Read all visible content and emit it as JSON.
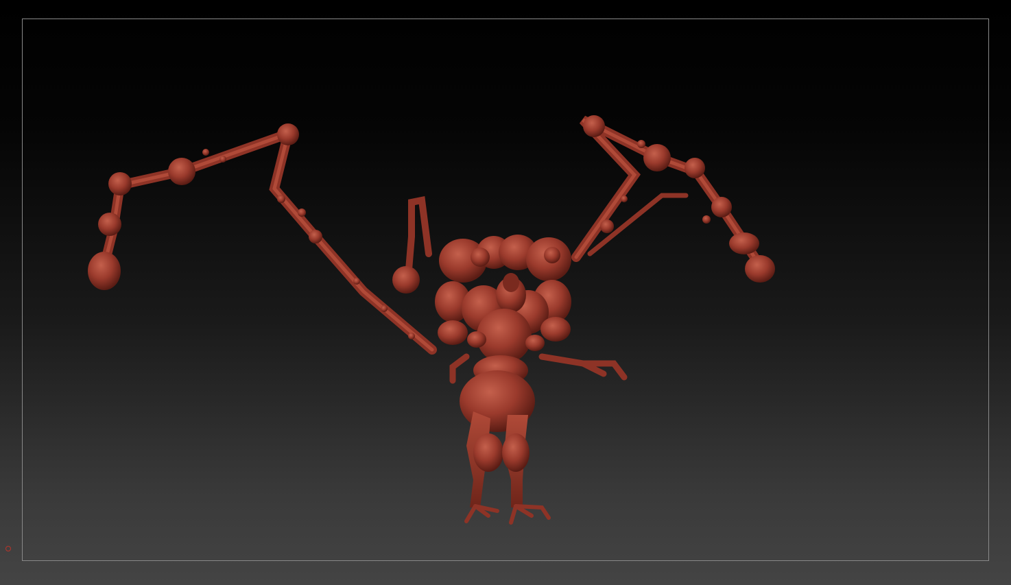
{
  "canvas": {
    "background_top_color": "#000000",
    "background_bottom_color": "#444444",
    "frame_border_color": "#8a8a8a"
  },
  "model": {
    "material_color": "#9a3a2c",
    "highlight_color": "#c4604c",
    "shadow_color": "#5a1c14"
  },
  "axis_indicator": {
    "icon": "axis-gizmo-icon",
    "color": "#b8342a"
  }
}
